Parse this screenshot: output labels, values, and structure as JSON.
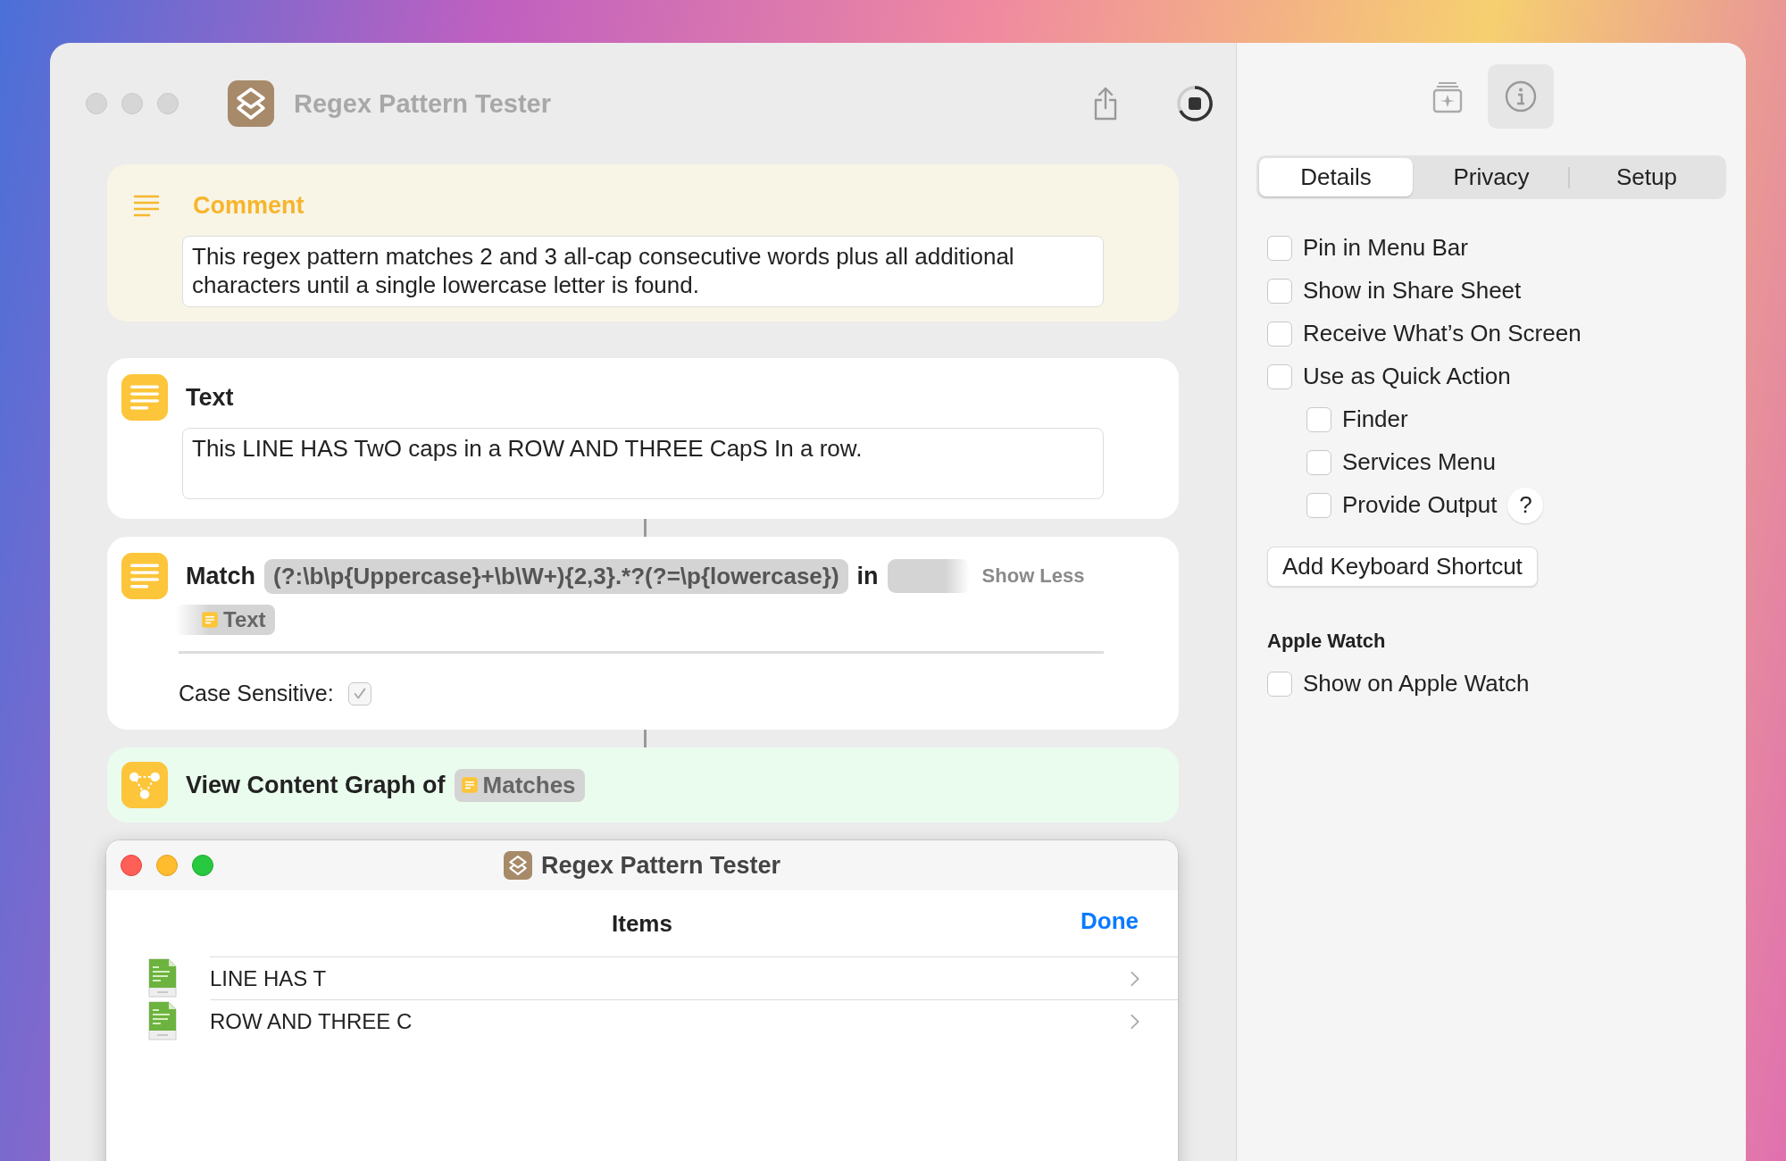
{
  "window": {
    "title": "Regex Pattern Tester"
  },
  "actions": [
    {
      "kind": "comment",
      "title": "Comment",
      "text": "This regex pattern matches 2 and 3 all-cap consecutive words plus all additional characters until a single lowercase letter is found."
    },
    {
      "kind": "text",
      "title": "Text",
      "value": "This LINE HAS TwO caps in a ROW AND THREE CapS In a row."
    },
    {
      "kind": "match",
      "title": "Match",
      "pattern": "(?:\\b\\p{Uppercase}+\\b\\W+){2,3}.*?(?=\\p{lowercase})",
      "in_label": "in",
      "toggle": "Show Less",
      "variable": "Text",
      "option_label": "Case Sensitive:",
      "checked": true
    },
    {
      "kind": "graph",
      "title": "View Content Graph of",
      "variable": "Matches"
    }
  ],
  "sheet": {
    "title": "Regex Pattern Tester",
    "heading": "Items",
    "done": "Done",
    "items": [
      {
        "label": "LINE HAS T"
      },
      {
        "label": "ROW AND THREE C"
      }
    ]
  },
  "inspector": {
    "tabs": [
      {
        "label": "Details",
        "selected": true
      },
      {
        "label": "Privacy",
        "selected": false
      },
      {
        "label": "Setup",
        "selected": false
      }
    ],
    "options": [
      {
        "label": "Pin in Menu Bar",
        "checked": false
      },
      {
        "label": "Show in Share Sheet",
        "checked": false
      },
      {
        "label": "Receive What’s On Screen",
        "checked": false
      },
      {
        "label": "Use as Quick Action",
        "checked": false,
        "children": [
          {
            "label": "Finder",
            "checked": false
          },
          {
            "label": "Services Menu",
            "checked": false
          },
          {
            "label": "Provide Output",
            "checked": false,
            "help": "?"
          }
        ]
      }
    ],
    "shortcut_button": "Add Keyboard Shortcut",
    "section": {
      "title": "Apple Watch",
      "options": [
        {
          "label": "Show on Apple Watch",
          "checked": false
        }
      ]
    }
  }
}
